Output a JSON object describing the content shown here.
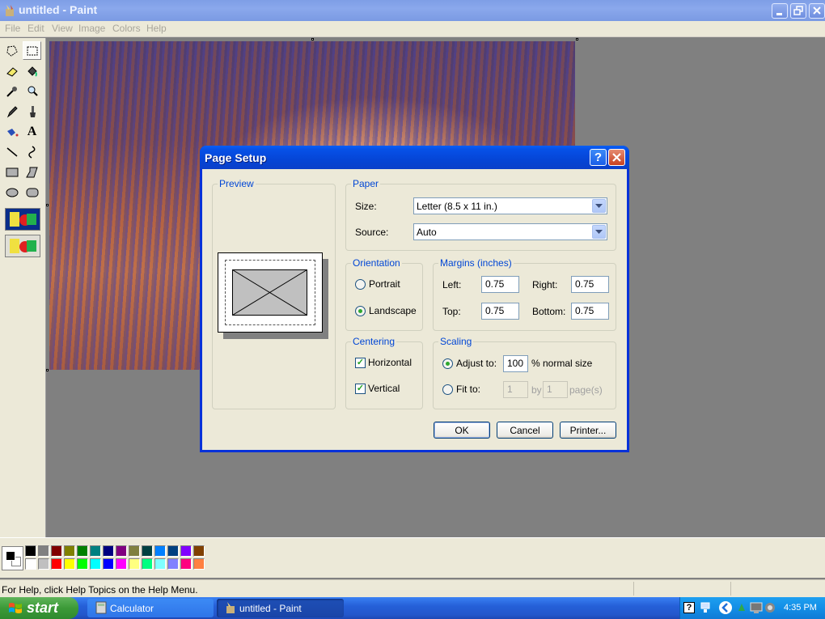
{
  "window": {
    "title": "untitled - Paint"
  },
  "menu": [
    "File",
    "Edit",
    "View",
    "Image",
    "Colors",
    "Help"
  ],
  "status_text": "For Help, click Help Topics on the Help Menu.",
  "palette": {
    "top": [
      "#000000",
      "#808080",
      "#800000",
      "#808000",
      "#008000",
      "#008080",
      "#000080",
      "#800080",
      "#808040",
      "#004040",
      "#0080ff",
      "#004080",
      "#8000ff",
      "#804000"
    ],
    "bottom": [
      "#ffffff",
      "#c0c0c0",
      "#ff0000",
      "#ffff00",
      "#00ff00",
      "#00ffff",
      "#0000ff",
      "#ff00ff",
      "#ffff80",
      "#00ff80",
      "#80ffff",
      "#8080ff",
      "#ff0080",
      "#ff8040"
    ]
  },
  "taskbar": {
    "start_label": "start",
    "items": [
      {
        "label": "Calculator",
        "active": false
      },
      {
        "label": "untitled - Paint",
        "active": true
      }
    ],
    "clock": "4:35 PM"
  },
  "dialog": {
    "title": "Page Setup",
    "preview_label": "Preview",
    "paper": {
      "label": "Paper",
      "size_label": "Size:",
      "size_value": "Letter (8.5 x 11 in.)",
      "source_label": "Source:",
      "source_value": "Auto"
    },
    "orientation": {
      "label": "Orientation",
      "portrait": "Portrait",
      "landscape": "Landscape",
      "selected": "landscape"
    },
    "margins": {
      "label": "Margins (inches)",
      "left_label": "Left:",
      "left": "0.75",
      "right_label": "Right:",
      "right": "0.75",
      "top_label": "Top:",
      "top": "0.75",
      "bottom_label": "Bottom:",
      "bottom": "0.75"
    },
    "centering": {
      "label": "Centering",
      "horizontal": "Horizontal",
      "vertical": "Vertical"
    },
    "scaling": {
      "label": "Scaling",
      "adjust_label": "Adjust to:",
      "adjust_value": "100",
      "normal_size": "% normal size",
      "fit_label": "Fit to:",
      "fit_w": "1",
      "by": "by",
      "fit_h": "1",
      "pages": "page(s)"
    },
    "buttons": {
      "ok": "OK",
      "cancel": "Cancel",
      "printer": "Printer..."
    }
  },
  "icons": [
    "paint-app-icon",
    "minimize-icon",
    "restore-icon",
    "close-icon",
    "help-icon",
    "dropdown-arrow-icon",
    "windows-flag-icon",
    "calculator-icon",
    "clock-tray"
  ]
}
